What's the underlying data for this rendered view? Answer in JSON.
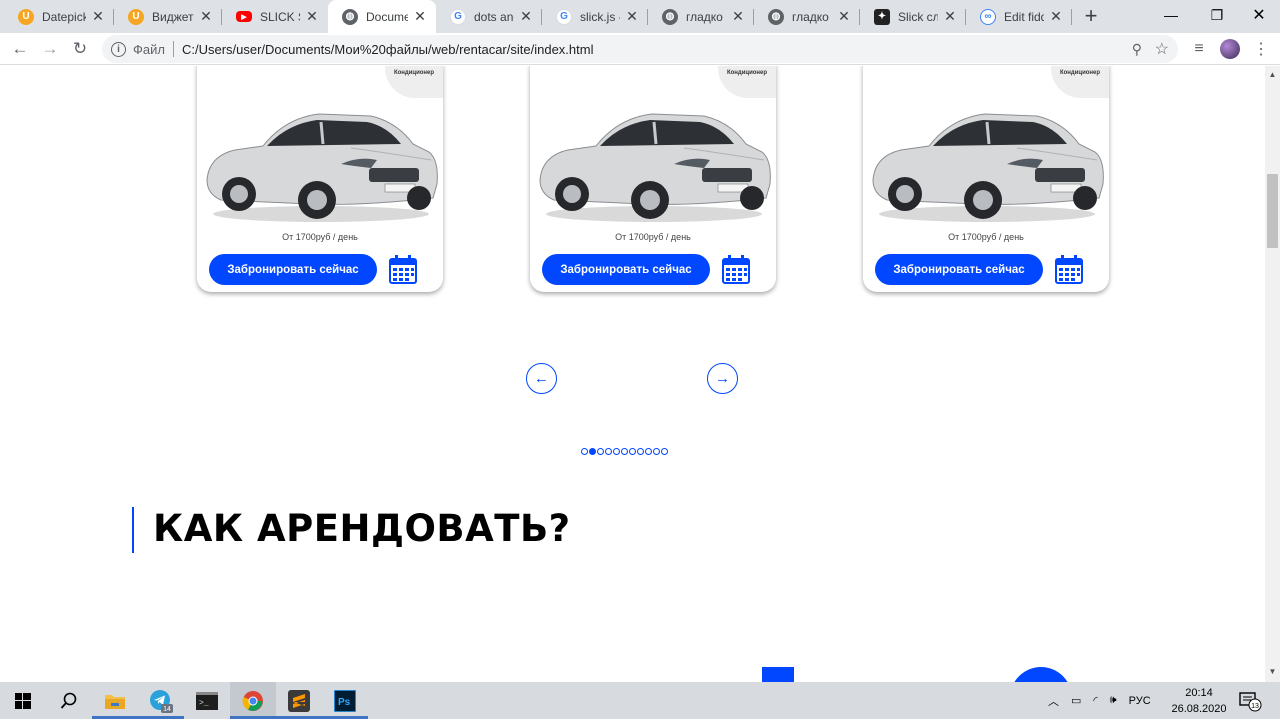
{
  "browser": {
    "tabs": [
      {
        "title": "Datepicker",
        "favicon": "mascot-icon",
        "color": "#f5a623",
        "active": false
      },
      {
        "title": "Виджет Datepicker",
        "favicon": "mascot-icon",
        "color": "#f5a623",
        "active": false
      },
      {
        "title": "SLICK SLIDER",
        "favicon": "youtube-icon",
        "color": "#ff0000",
        "active": false
      },
      {
        "title": "Document",
        "favicon": "globe-icon",
        "color": "#5f6368",
        "active": true
      },
      {
        "title": "dots and arrows",
        "favicon": "google-icon",
        "color": "#4285f4",
        "active": false
      },
      {
        "title": "slick.js - Google",
        "favicon": "google-icon",
        "color": "#4285f4",
        "active": false
      },
      {
        "title": "гладко - ",
        "favicon": "globe-icon",
        "color": "#5f6368",
        "active": false
      },
      {
        "title": "гладко - ",
        "favicon": "globe-icon",
        "color": "#5f6368",
        "active": false
      },
      {
        "title": "Slick слайдер",
        "favicon": "slick-icon",
        "color": "#222222",
        "active": false
      },
      {
        "title": "Edit fiddle",
        "favicon": "jsfiddle-icon",
        "color": "#3b82f6",
        "active": false
      }
    ],
    "omnibox": {
      "scheme": "Файл",
      "path": "C:/Users/user/Documents/Мои%20файлы/web/rentacar/site/index.html"
    }
  },
  "page": {
    "cars": [
      {
        "badge": "Кондиционер",
        "price": "От 1700руб / день",
        "book_label": "Забронировать сейчас"
      },
      {
        "badge": "Кондиционер",
        "price": "От 1700руб / день",
        "book_label": "Забронировать сейчас"
      },
      {
        "badge": "Кондиционер",
        "price": "От 1700руб / день",
        "book_label": "Забронировать сейчас"
      }
    ],
    "slider": {
      "dot_count": 11,
      "active_dot": 1
    },
    "section_title": "КАК АРЕНДОВАТЬ?",
    "accent_color": "#0047ff"
  },
  "taskbar": {
    "apps": [
      "windows-start-icon",
      "search-icon",
      "file-explorer-icon",
      "telegram-icon",
      "terminal-icon",
      "chrome-icon",
      "sublime-text-icon",
      "photoshop-icon"
    ],
    "telegram_badge": "14",
    "lang": "РУС",
    "time": "20:14",
    "date": "26.08.2020",
    "notifications": "13"
  }
}
